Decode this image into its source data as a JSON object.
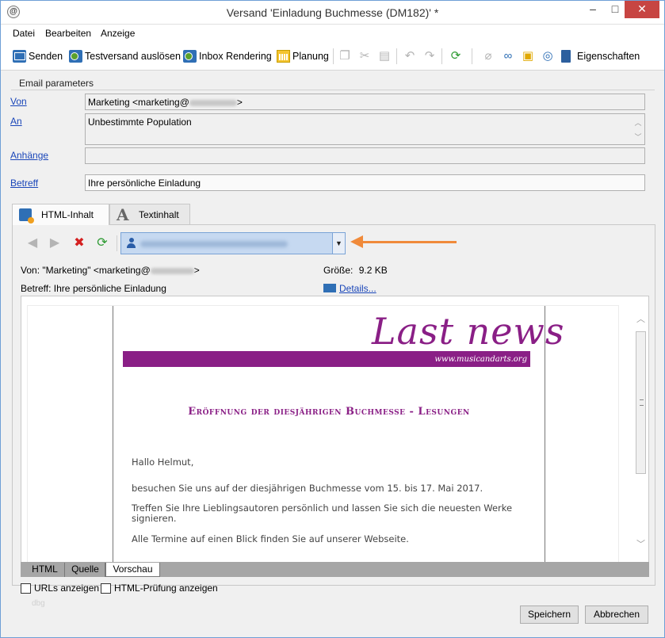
{
  "window": {
    "title": "Versand 'Einladung Buchmesse (DM182)' *",
    "app_icon": "@",
    "minimize": "–",
    "maximize": "□",
    "close": "✕"
  },
  "menu": [
    "Datei",
    "Bearbeiten",
    "Anzeige"
  ],
  "toolbar": {
    "send": "Senden",
    "test_send": "Testversand auslösen",
    "inbox_rendering": "Inbox Rendering",
    "planning": "Planung",
    "properties": "Eigenschaften"
  },
  "params": {
    "title": "Email parameters",
    "from_label": "Von",
    "from_value_prefix": "Marketing <marketing@",
    "from_value_suffix": ">",
    "to_label": "An",
    "to_value": "Unbestimmte Population",
    "attachments_label": "Anhänge",
    "attachments_value": "",
    "subject_label": "Betreff",
    "subject_value": "Ihre persönliche Einladung"
  },
  "tabs": {
    "html": "HTML-Inhalt",
    "text": "Textinhalt"
  },
  "preview_meta": {
    "from_line_prefix": "Von:  \"Marketing\" <marketing@",
    "from_line_suffix": ">",
    "subject_line": "Betreff:  Ihre persönliche Einladung",
    "size_label": "Größe:",
    "size_value": "9.2 KB",
    "details_link": "Details..."
  },
  "email": {
    "brand": "Last news",
    "url": "www.musicandarts.org",
    "headline": "Eröffnung der diesjährigen Buchmesse - Lesungen",
    "greeting": "Hallo Helmut,",
    "p1": "besuchen Sie uns auf der diesjährigen Buchmesse vom 15. bis 17. Mai 2017.",
    "p2": "Treffen Sie Ihre Lieblingsautoren persönlich und lassen Sie sich die neuesten Werke signieren.",
    "p3": "Alle Termine auf einen Blick finden Sie auf unserer Webseite."
  },
  "subtabs": [
    "HTML",
    "Quelle",
    "Vorschau"
  ],
  "checkboxes": {
    "urls": "URLs anzeigen",
    "html_check": "HTML-Prüfung anzeigen"
  },
  "faint_text": "dbg",
  "buttons": {
    "save": "Speichern",
    "cancel": "Abbrechen"
  },
  "colors": {
    "brand_purple": "#8a1f86",
    "link_blue": "#1a46b9",
    "annotation_orange": "#f08a3a"
  }
}
